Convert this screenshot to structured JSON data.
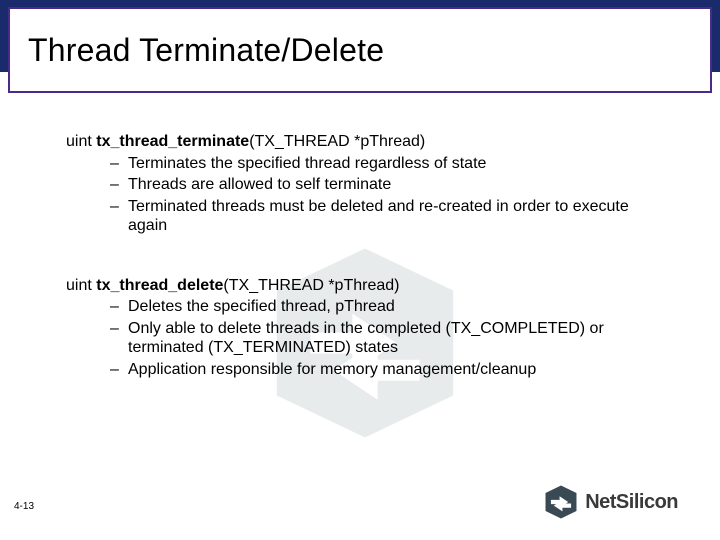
{
  "title": "Thread Terminate/Delete",
  "sections": [
    {
      "prefix": "uint ",
      "fn": "tx_thread_terminate",
      "args": "(TX_THREAD *pThread)",
      "bullets": [
        "Terminates the specified thread regardless of state",
        "Threads are allowed to self terminate",
        "Terminated threads must be deleted and re-created in order to execute again"
      ]
    },
    {
      "prefix": "uint ",
      "fn": "tx_thread_delete",
      "args": "(TX_THREAD *pThread)",
      "bullets": [
        "Deletes the specified thread, pThread",
        "Only able to delete threads in the completed (TX_COMPLETED) or terminated (TX_TERMINATED) states",
        "Application responsible for memory management/cleanup"
      ]
    }
  ],
  "page_number": "4-13",
  "logo_text": "NetSilicon"
}
